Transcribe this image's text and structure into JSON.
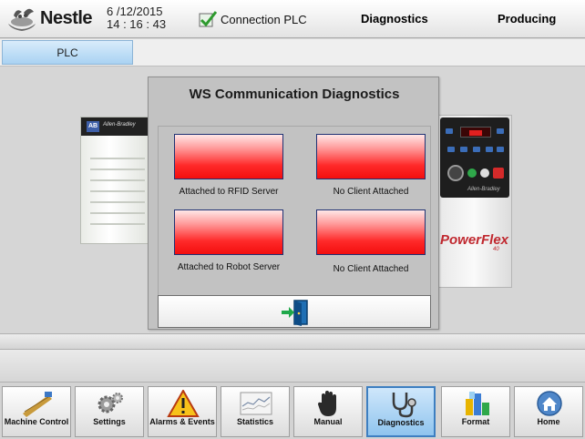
{
  "header": {
    "brand": "Nestle",
    "date": "6 /12/2015",
    "time": "14 : 16 : 43",
    "connection": "Connection PLC",
    "screen_title": "Diagnostics",
    "machine_state": "Producing"
  },
  "tabs": [
    {
      "label": "PLC",
      "active": true
    }
  ],
  "devices": {
    "plc_vendor": "Allen-Bradley",
    "drive_brand": "PowerFlex",
    "drive_sub": "40"
  },
  "dialog": {
    "title": "WS Communication Diagnostics",
    "channels": [
      {
        "label": "Attached to RFID Server",
        "color": "#f31a1a"
      },
      {
        "label": "No Client Attached",
        "color": "#f31a1a"
      },
      {
        "label": "Attached to Robot Server",
        "color": "#f31a1a"
      },
      {
        "label": "No Client Attached",
        "color": "#f31a1a"
      }
    ],
    "exit_icon": "exit-door-icon"
  },
  "nav": [
    {
      "label": "Machine Control",
      "icon": "machine-control-icon",
      "active": false
    },
    {
      "label": "Settings",
      "icon": "gears-icon",
      "active": false
    },
    {
      "label": "Alarms & Events",
      "icon": "warning-icon",
      "active": false
    },
    {
      "label": "Statistics",
      "icon": "chart-icon",
      "active": false
    },
    {
      "label": "Manual",
      "icon": "hand-icon",
      "active": false
    },
    {
      "label": "Diagnostics",
      "icon": "stethoscope-icon",
      "active": true
    },
    {
      "label": "Format",
      "icon": "format-icon",
      "active": false
    },
    {
      "label": "Home",
      "icon": "home-icon",
      "active": false
    }
  ],
  "colors": {
    "active_nav": "#8fc4ee",
    "status_red": "#f31a1a",
    "status_border": "#1f3173"
  }
}
